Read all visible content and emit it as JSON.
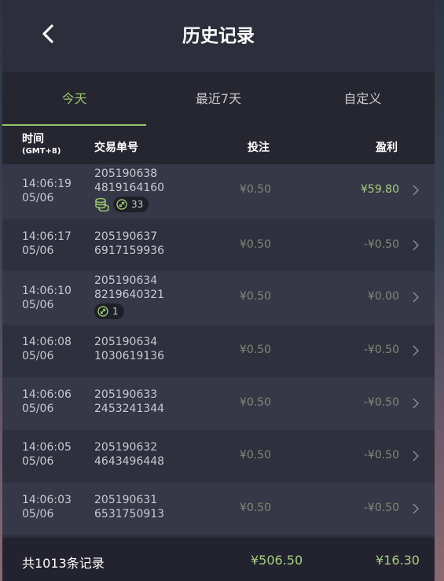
{
  "header": {
    "title": "历史记录"
  },
  "tabs": [
    {
      "label": "今天"
    },
    {
      "label": "最近7天"
    },
    {
      "label": "自定义"
    }
  ],
  "columns": {
    "time": "时间",
    "timezone": "(GMT+8)",
    "order_id": "交易单号",
    "bet": "投注",
    "win": "盈利"
  },
  "rows": [
    {
      "time": "14:06:19",
      "date": "05/06",
      "id1": "205190638",
      "id2": "4819164160",
      "bet": "¥0.50",
      "win": "¥59.80",
      "win_positive": true,
      "coins": true,
      "count": "33"
    },
    {
      "time": "14:06:17",
      "date": "05/06",
      "id1": "205190637",
      "id2": "6917159936",
      "bet": "¥0.50",
      "win": "-¥0.50"
    },
    {
      "time": "14:06:10",
      "date": "05/06",
      "id1": "205190634",
      "id2": "8219640321",
      "bet": "¥0.50",
      "win": "¥0.00",
      "count": "1"
    },
    {
      "time": "14:06:08",
      "date": "05/06",
      "id1": "205190634",
      "id2": "1030619136",
      "bet": "¥0.50",
      "win": "-¥0.50"
    },
    {
      "time": "14:06:06",
      "date": "05/06",
      "id1": "205190633",
      "id2": "2453241344",
      "bet": "¥0.50",
      "win": "-¥0.50"
    },
    {
      "time": "14:06:05",
      "date": "05/06",
      "id1": "205190632",
      "id2": "4643496448",
      "bet": "¥0.50",
      "win": "-¥0.50"
    },
    {
      "time": "14:06:03",
      "date": "05/06",
      "id1": "205190631",
      "id2": "6531750913",
      "bet": "¥0.50",
      "win": "-¥0.50"
    }
  ],
  "footer": {
    "total": "共1013条记录",
    "bet_total": "¥506.50",
    "win_total": "¥16.30"
  },
  "colors": {
    "accent": "#9ac46a",
    "panel": "#2d2e3b",
    "positive": "#a7cc7e"
  }
}
